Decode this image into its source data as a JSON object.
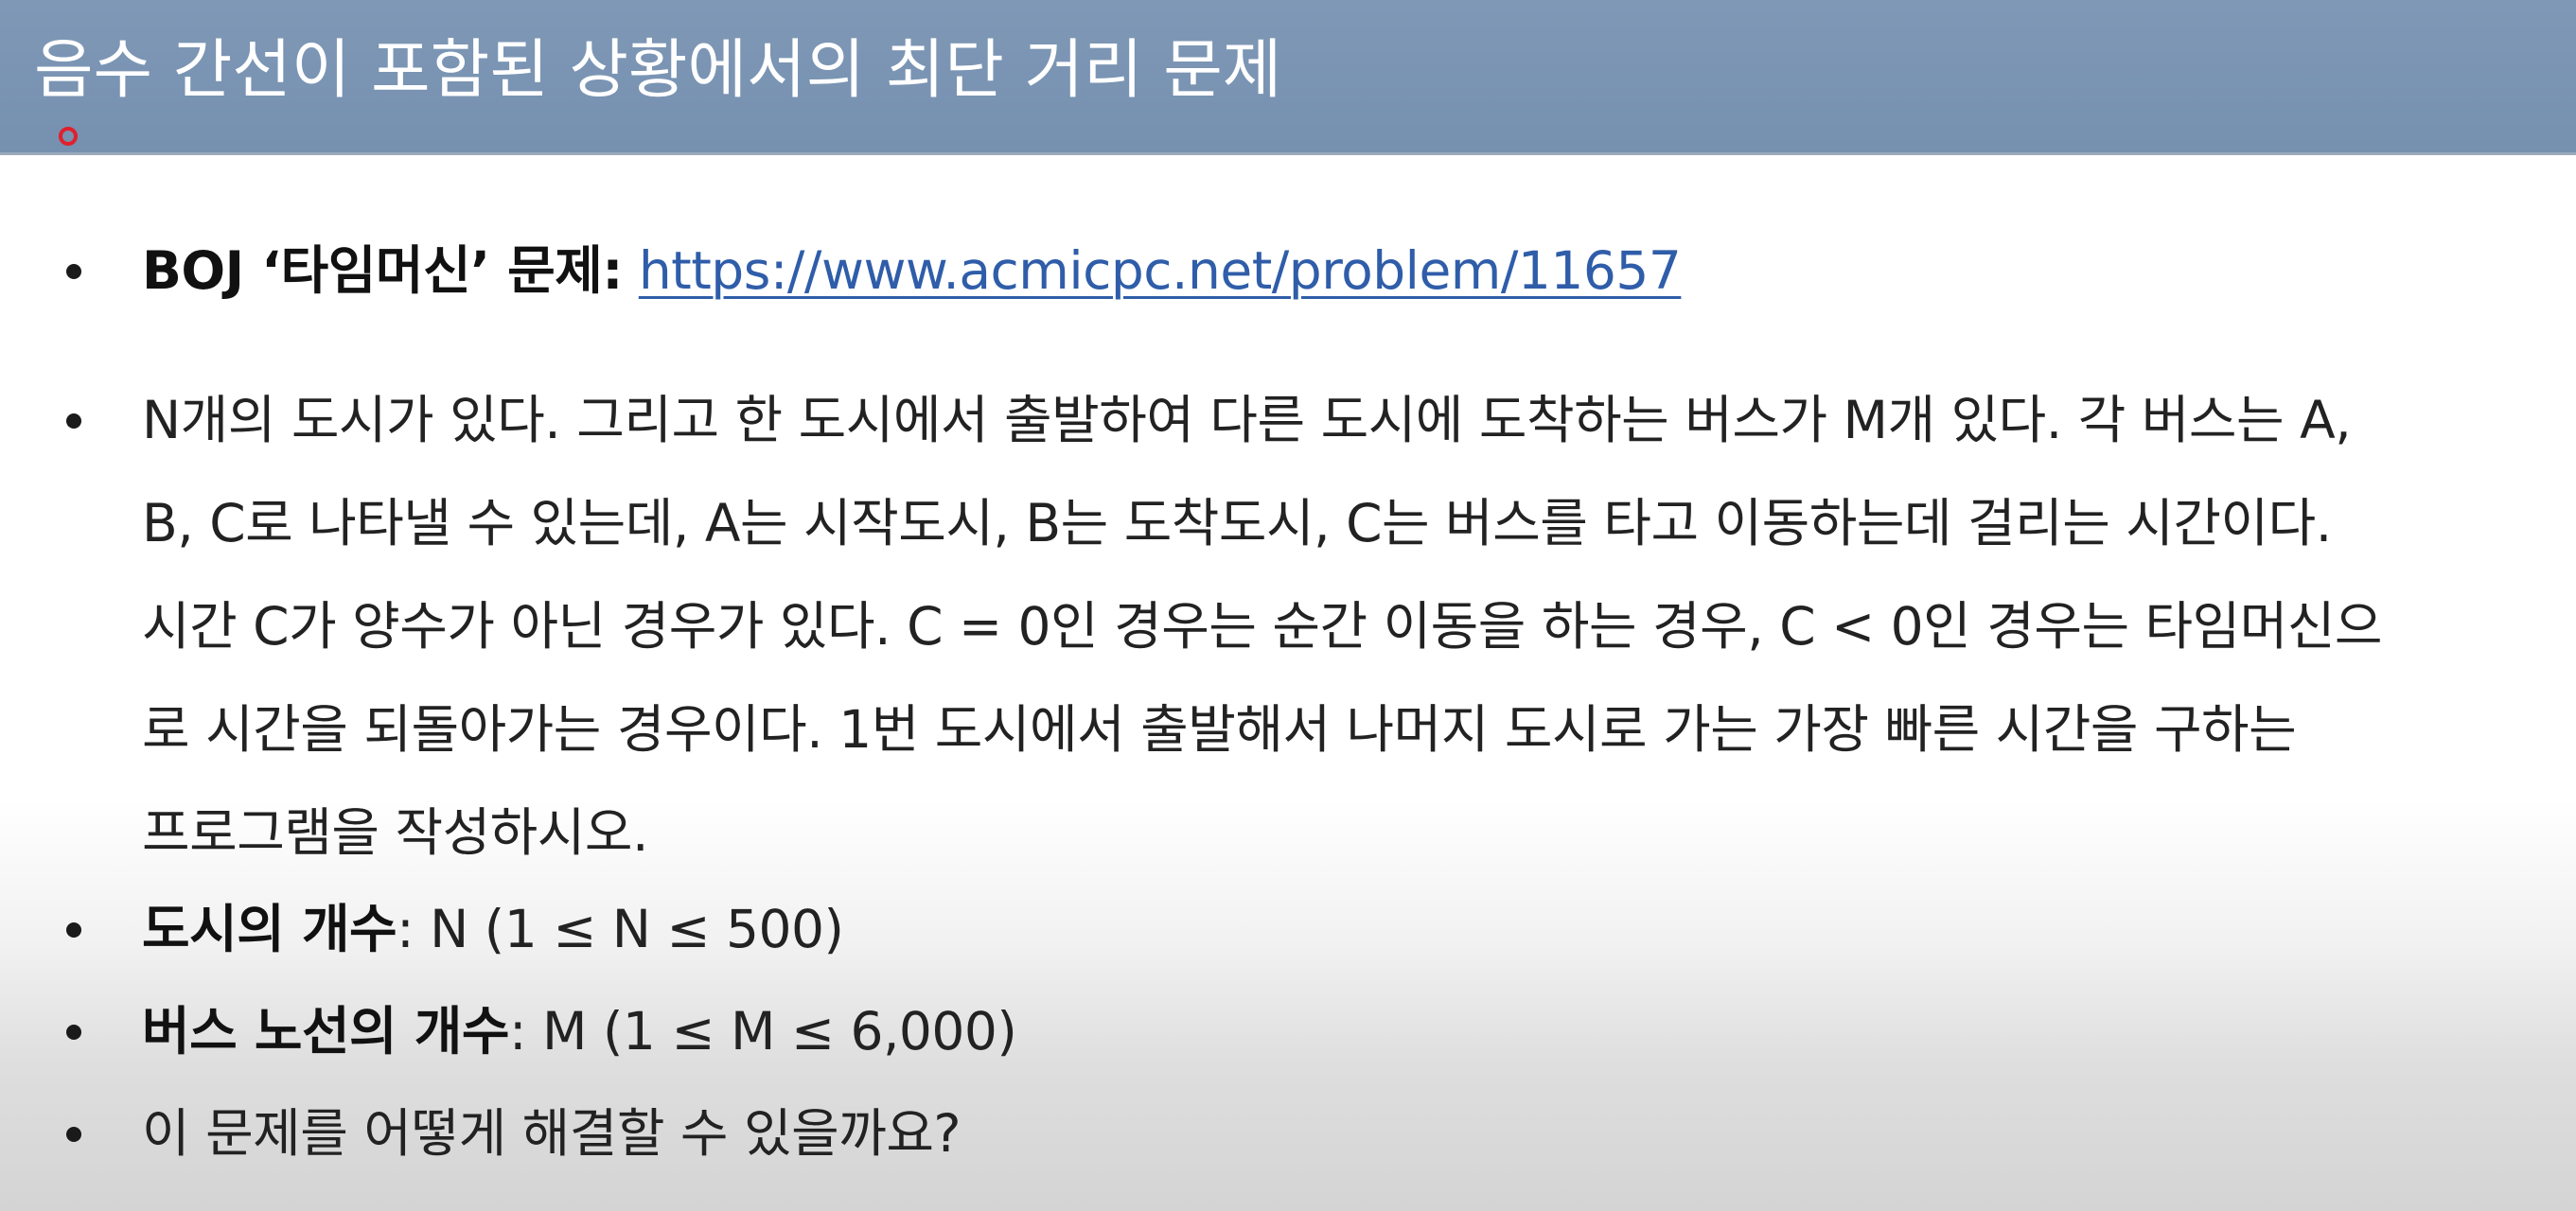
{
  "slide": {
    "title": "음수 간선이 포함된 상황에서의 최단 거리 문제",
    "bullets": {
      "boj": {
        "label": "BOJ ‘타임머신’ 문제:",
        "link": "https://www.acmicpc.net/problem/11657"
      },
      "description": {
        "lines": [
          "N개의 도시가 있다. 그리고 한 도시에서 출발하여 다른 도시에 도착하는 버스가 M개 있다. 각 버스는 A,",
          "B, C로 나타낼 수 있는데, A는 시작도시, B는 도착도시, C는 버스를 타고 이동하는데 걸리는 시간이다.",
          "시간 C가 양수가 아닌 경우가 있다. C = 0인 경우는 순간 이동을 하는 경우, C < 0인 경우는 타임머신으",
          "로 시간을 되돌아가는 경우이다. 1번 도시에서 출발해서 나머지 도시로 가는 가장 빠른 시간을 구하는",
          "프로그램을 작성하시오."
        ]
      },
      "cities": {
        "label": "도시의 개수",
        "value": ": N (1 ≤ N ≤ 500)"
      },
      "buses": {
        "label": "버스 노선의 개수",
        "value": ": M (1 ≤ M ≤ 6,000)"
      },
      "question": {
        "text": "이 문제를 어떻게 해결할 수 있을까요?"
      }
    }
  }
}
